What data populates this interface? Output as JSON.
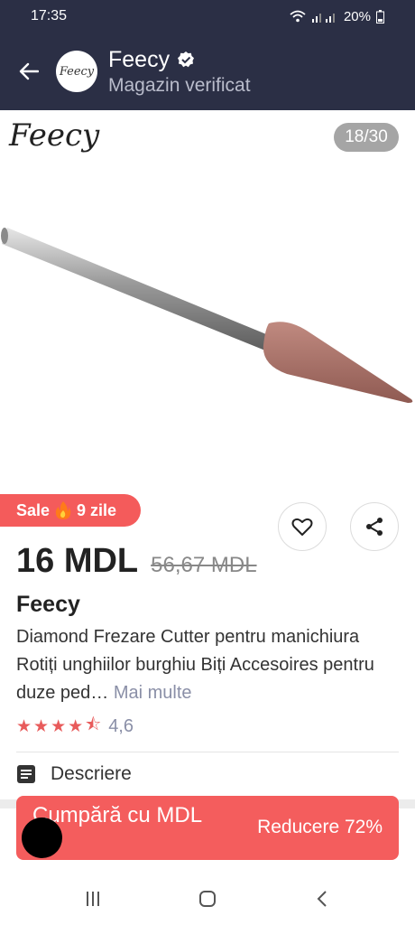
{
  "status_bar": {
    "time": "17:35",
    "battery": "20%"
  },
  "header": {
    "store_logo_text": "Feecy",
    "store_name": "Feecy",
    "store_subtitle": "Magazin verificat"
  },
  "gallery": {
    "logo_text": "Feecy",
    "counter": "18/30"
  },
  "product": {
    "sale_label": "Sale",
    "sale_days": "9 zile",
    "price": "16 MDL",
    "old_price": "56,67 MDL",
    "brand": "Feecy",
    "description": "Diamond Frezare Cutter pentru manichiura Rotiți unghiilor burghiu Biți Accesoires pentru duze ped…",
    "more_link": "Mai multe",
    "rating": "4,6",
    "rating_stars": 4.6,
    "description_section": "Descriere"
  },
  "buy_bar": {
    "label": "Cumpără cu MDL",
    "discount": "Reducere 72%"
  },
  "colors": {
    "header_bg": "#2b2f45",
    "accent_red": "#f45b5b",
    "muted_text": "#8a8fa7"
  },
  "icons": {
    "back": "arrow-left-icon",
    "verified": "verified-badge-icon",
    "heart": "heart-icon",
    "share": "share-icon",
    "fire": "fire-icon",
    "description": "document-icon",
    "nav_recent": "recent-apps-icon",
    "nav_home": "home-icon",
    "nav_back": "nav-back-icon"
  }
}
